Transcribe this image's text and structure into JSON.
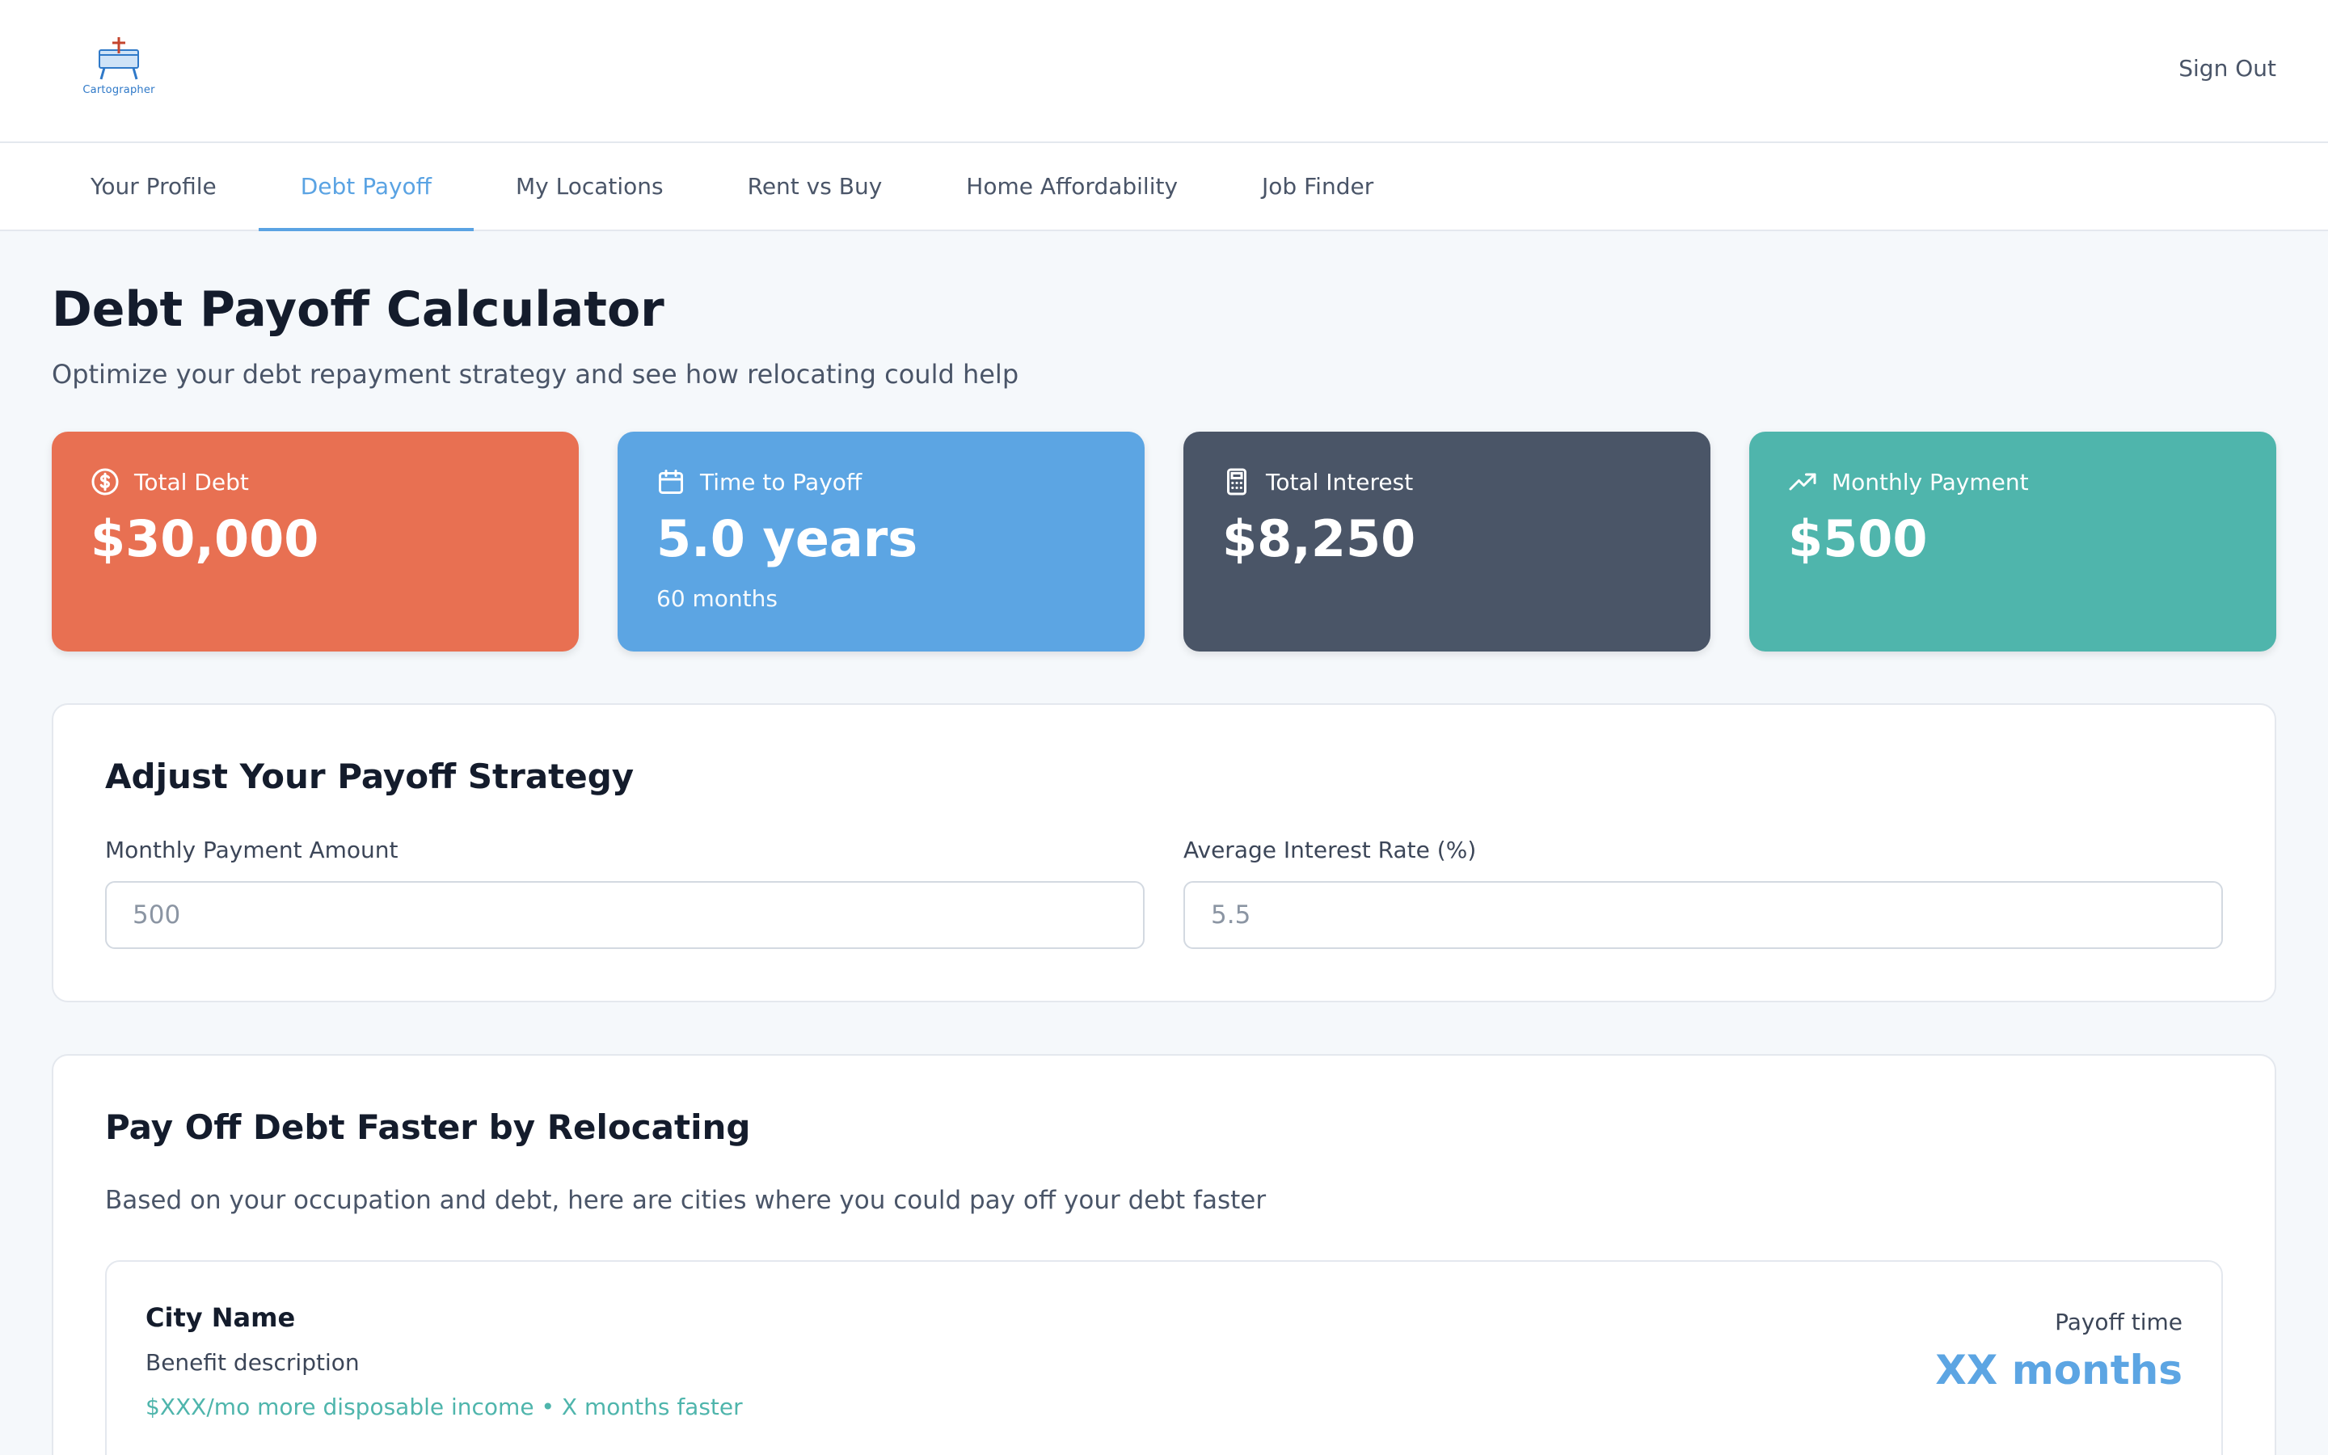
{
  "header": {
    "logo_text": "Cartographer",
    "sign_out": "Sign Out"
  },
  "tabs": [
    {
      "label": "Your Profile",
      "active": false
    },
    {
      "label": "Debt Payoff",
      "active": true
    },
    {
      "label": "My Locations",
      "active": false
    },
    {
      "label": "Rent vs Buy",
      "active": false
    },
    {
      "label": "Home Affordability",
      "active": false
    },
    {
      "label": "Job Finder",
      "active": false
    }
  ],
  "page": {
    "title": "Debt Payoff Calculator",
    "subtitle": "Optimize your debt repayment strategy and see how relocating could help"
  },
  "stats": [
    {
      "label": "Total Debt",
      "value": "$30,000",
      "sub": "",
      "icon": "dollar-circle-icon",
      "color": "#e87052"
    },
    {
      "label": "Time to Payoff",
      "value": "5.0 years",
      "sub": "60 months",
      "icon": "calendar-icon",
      "color": "#5ca5e3"
    },
    {
      "label": "Total Interest",
      "value": "$8,250",
      "sub": "",
      "icon": "calculator-icon",
      "color": "#4a5567"
    },
    {
      "label": "Monthly Payment",
      "value": "$500",
      "sub": "",
      "icon": "trending-up-icon",
      "color": "#4fb5ac"
    }
  ],
  "strategy": {
    "title": "Adjust Your Payoff Strategy",
    "monthly_label": "Monthly Payment Amount",
    "monthly_placeholder": "500",
    "rate_label": "Average Interest Rate (%)",
    "rate_placeholder": "5.5"
  },
  "relocate": {
    "title": "Pay Off Debt Faster by Relocating",
    "subtitle": "Based on your occupation and debt, here are cities where you could pay off your debt faster",
    "city": {
      "name": "City Name",
      "description": "Benefit description",
      "gain": "$XXX/mo more disposable income • X months faster",
      "payoff_label": "Payoff time",
      "payoff_value": "XX months"
    }
  }
}
